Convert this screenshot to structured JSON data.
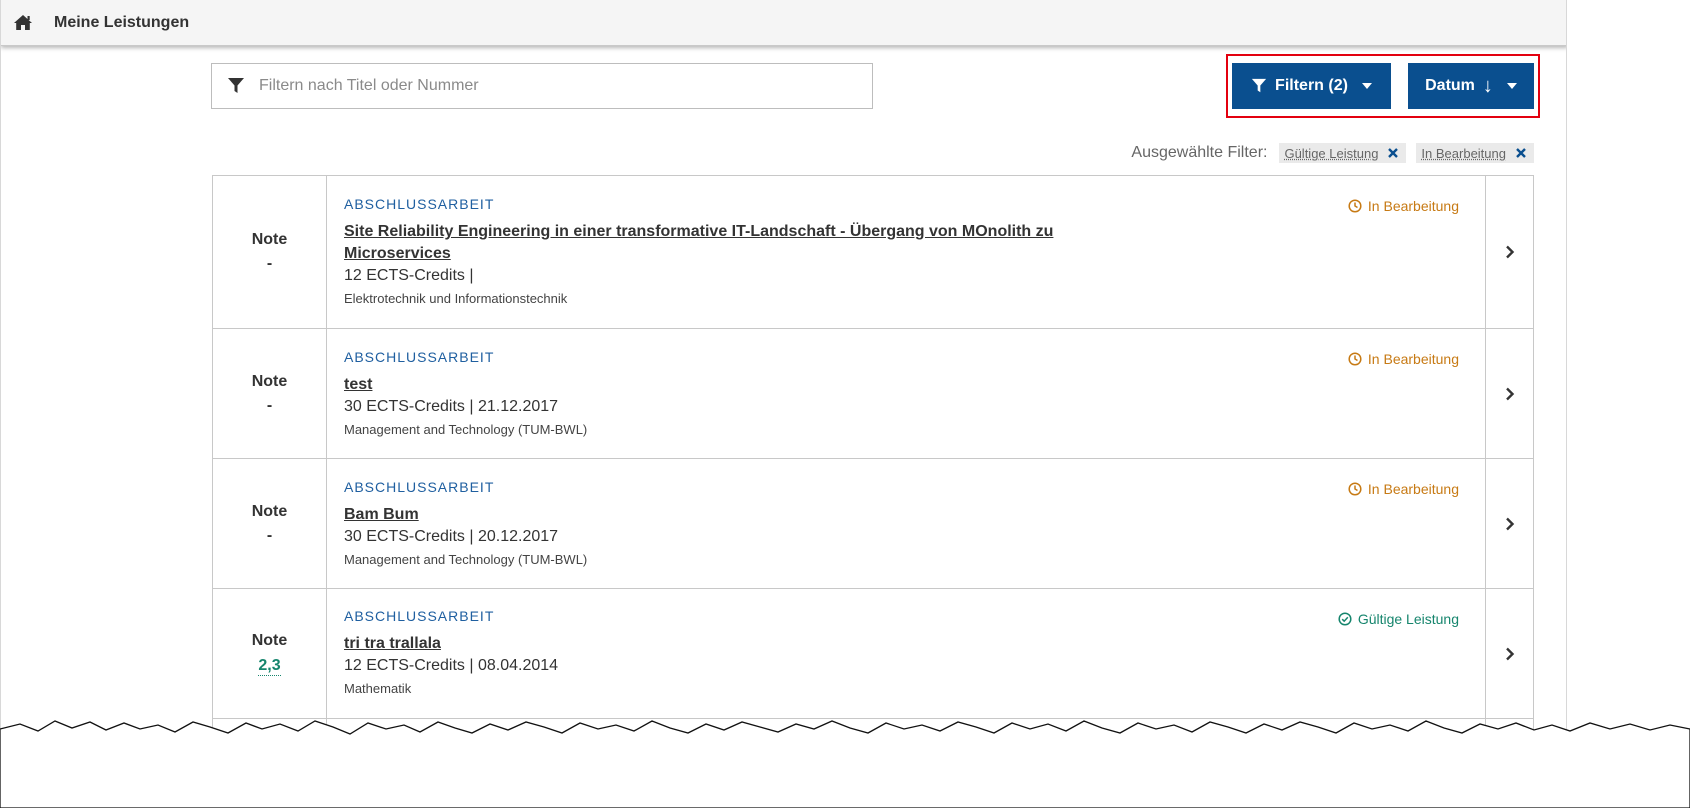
{
  "header": {
    "title": "Meine Leistungen"
  },
  "search": {
    "placeholder": "Filtern nach Titel oder Nummer",
    "value": ""
  },
  "toolbar": {
    "filter_label": "Filtern (2)",
    "sort_label": "Datum",
    "sort_arrow": "↓"
  },
  "selected_filters": {
    "label": "Ausgewählte Filter:",
    "chips": [
      "Gültige Leistung",
      "In Bearbeitung"
    ]
  },
  "colors": {
    "primary": "#0a4f8f",
    "highlight": "#e3000f",
    "status_progress": "#c77a14",
    "status_valid": "#16856d"
  },
  "items": [
    {
      "grade_label": "Note",
      "grade": "-",
      "type": "ABSCHLUSSARBEIT",
      "title_line1": "Site Reliability Engineering in einer transformative IT-Landschaft - Übergang von MOnolith zu",
      "title_line2": "Microservices",
      "meta": "12 ECTS-Credits |",
      "dept": "Elektrotechnik und Informationstechnik",
      "status": "In Bearbeitung",
      "status_icon": "clock-icon"
    },
    {
      "grade_label": "Note",
      "grade": "-",
      "type": "ABSCHLUSSARBEIT",
      "title_line1": "test",
      "title_line2": "",
      "meta": "30 ECTS-Credits | 21.12.2017",
      "dept": "Management and Technology (TUM-BWL)",
      "status": "In Bearbeitung",
      "status_icon": "clock-icon"
    },
    {
      "grade_label": "Note",
      "grade": "-",
      "type": "ABSCHLUSSARBEIT",
      "title_line1": "Bam Bum",
      "title_line2": "",
      "meta": "30 ECTS-Credits | 20.12.2017",
      "dept": "Management and Technology (TUM-BWL)",
      "status": "In Bearbeitung",
      "status_icon": "clock-icon"
    },
    {
      "grade_label": "Note",
      "grade": "2,3",
      "type": "ABSCHLUSSARBEIT",
      "title_line1": "tri tra trallala",
      "title_line2": "",
      "meta": "12 ECTS-Credits | 08.04.2014",
      "dept": "Mathematik",
      "status": "Gültige Leistung",
      "status_icon": "check-circle-icon"
    }
  ]
}
